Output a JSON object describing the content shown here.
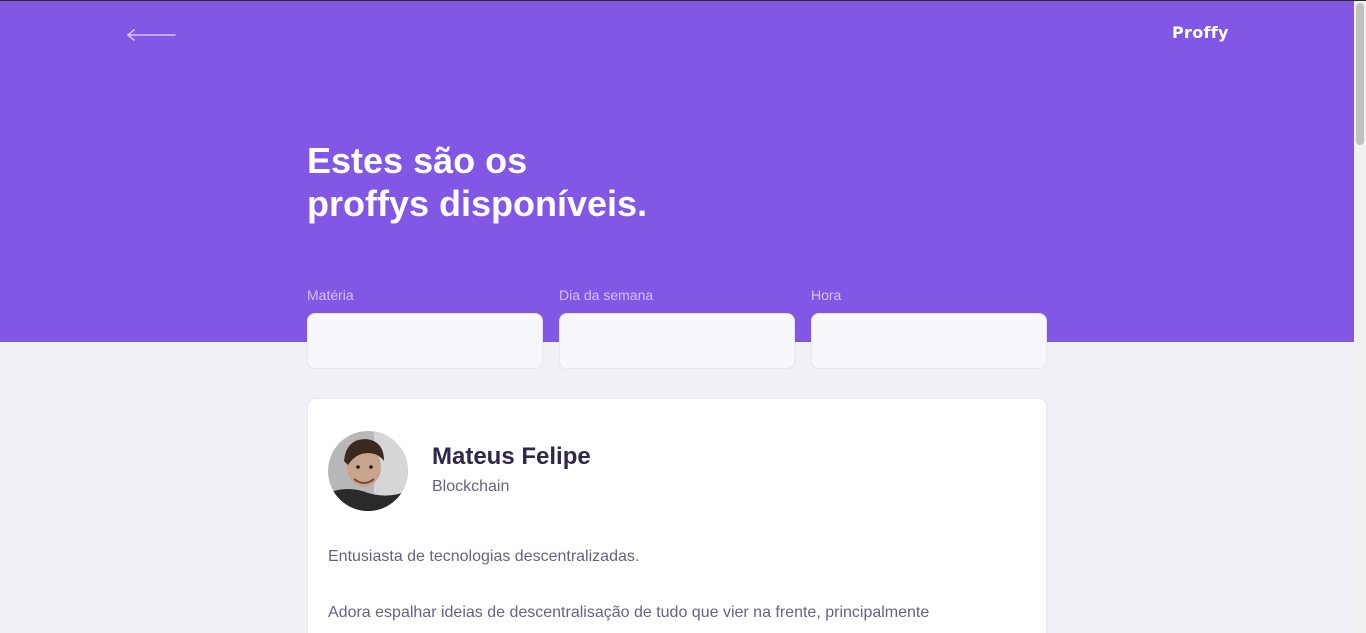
{
  "header": {
    "logo_text": "Proffy",
    "back_icon": "arrow-left-icon",
    "title_line1": "Estes são os",
    "title_line2": "proffys disponíveis."
  },
  "filters": {
    "subject_label": "Matéria",
    "subject_value": "",
    "weekday_label": "Dia da semana",
    "weekday_value": "",
    "time_label": "Hora",
    "time_value": ""
  },
  "teacher": {
    "name": "Mateus Felipe",
    "subject": "Blockchain",
    "bio_paragraph1": "Entusiasta de tecnologias descentralizadas.",
    "bio_paragraph2": "Adora espalhar ideias de descentralisação de tudo que vier na frente, principalmente"
  },
  "colors": {
    "primary": "#8257e5",
    "background": "#f0f0f7",
    "title_text": "#32264d",
    "body_text": "#6a6180",
    "label_text": "#d4c2ff"
  }
}
